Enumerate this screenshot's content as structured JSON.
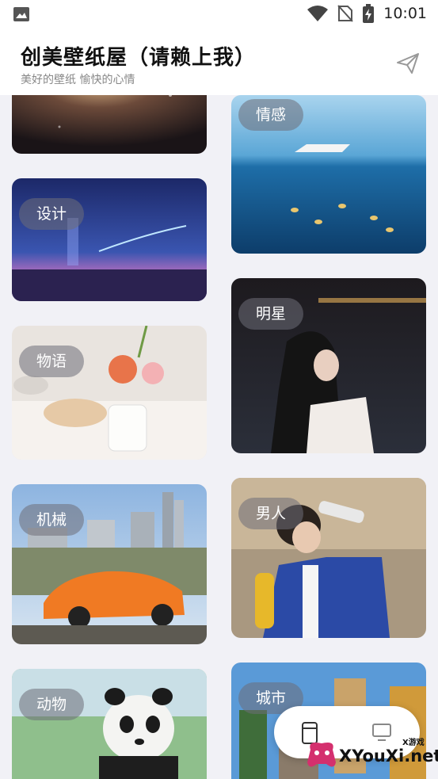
{
  "status_bar": {
    "time": "10:01",
    "icons": [
      "image-icon",
      "wifi-icon",
      "no-sim-icon",
      "battery-charging-icon"
    ]
  },
  "app": {
    "title": "创美壁纸屋（请赖上我）",
    "subtitle": "美好的壁纸 愉快的心情",
    "action_icon": "paper-plane-icon"
  },
  "categories": {
    "left": [
      "设计",
      "物语",
      "机械",
      "动物"
    ],
    "right": [
      "情感",
      "明星",
      "男人",
      "城市"
    ]
  },
  "bottom_switcher": {
    "icons": [
      "phone-icon",
      "monitor-icon"
    ]
  },
  "watermark": {
    "text": "XYouXi.net",
    "small": "X游戏"
  },
  "colors": {
    "background": "#f1f1f6",
    "bar": "#ffffff",
    "tag_bg": "rgba(110,110,120,0.55)"
  }
}
